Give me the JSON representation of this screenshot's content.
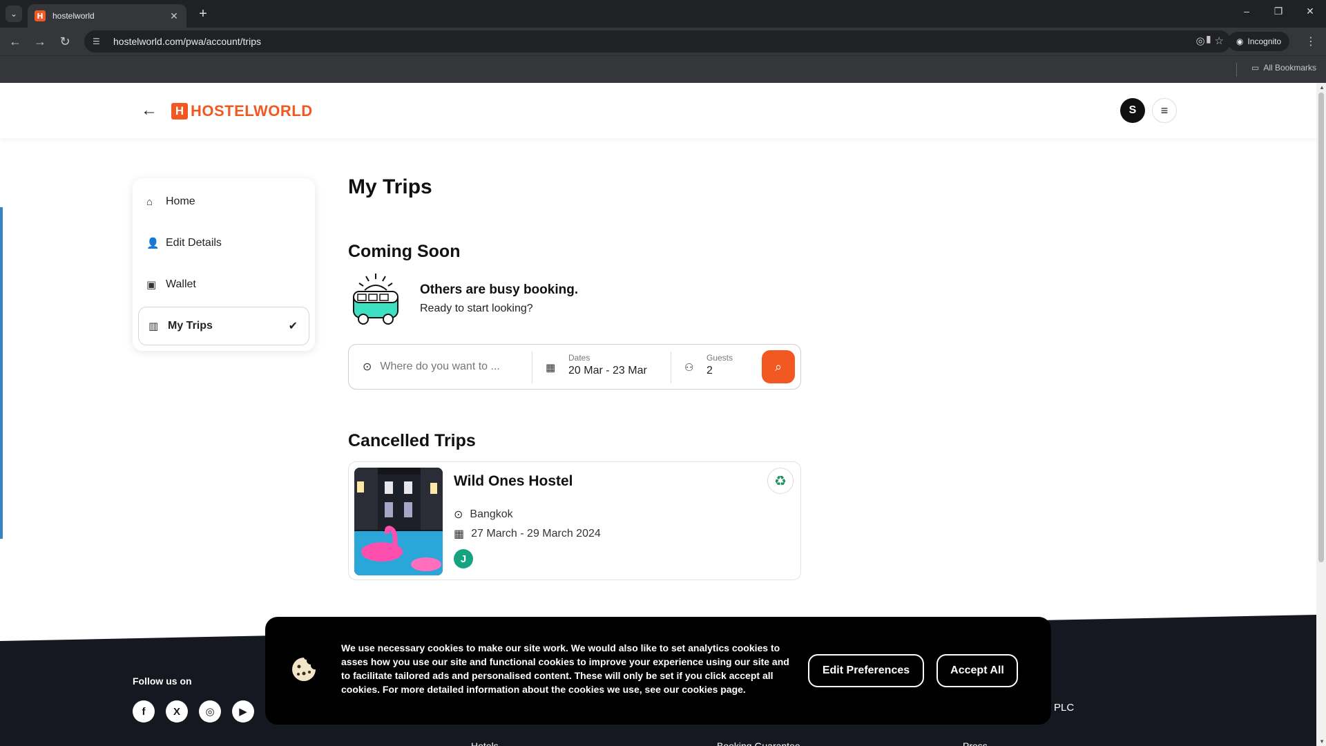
{
  "browser": {
    "tab_title": "hostelworld",
    "favicon_letter": "H",
    "url": "hostelworld.com/pwa/account/trips",
    "incognito_label": "Incognito",
    "bookmarks_label": "All Bookmarks"
  },
  "header": {
    "logo_letter": "H",
    "logo_text": "HOSTELWORLD",
    "avatar_initial": "S"
  },
  "sidebar": {
    "items": [
      {
        "label": "Home",
        "icon": "home-icon"
      },
      {
        "label": "Edit Details",
        "icon": "user-icon"
      },
      {
        "label": "Wallet",
        "icon": "wallet-icon"
      },
      {
        "label": "My Trips",
        "icon": "map-icon",
        "active": true
      }
    ]
  },
  "main": {
    "page_title": "My Trips",
    "coming_soon_title": "Coming Soon",
    "promo_headline": "Others are busy booking.",
    "promo_subtext": "Ready to start looking?",
    "search": {
      "where_placeholder": "Where do you want to ...",
      "dates_label": "Dates",
      "dates_value": "20 Mar - 23 Mar",
      "guests_label": "Guests",
      "guests_value": "2"
    },
    "cancelled_title": "Cancelled Trips",
    "trip": {
      "name": "Wild Ones Hostel",
      "location": "Bangkok",
      "dates": "27 March - 29 March 2024",
      "badge_letter": "J"
    }
  },
  "footer": {
    "follow_label": "Follow us on",
    "links": [
      "Hotels",
      "Booking Guarantee",
      "Press"
    ],
    "plc_text": "PLC"
  },
  "cookie": {
    "text": "We use necessary cookies to make our site work. We would also like to set analytics cookies to asses how you use our site and functional cookies to improve your experience using our site and to facilitate tailored ads and personalised content. These will only be set if you click accept all cookies. For more detailed information about the cookies we use, see our cookies page.",
    "edit_label": "Edit Preferences",
    "accept_label": "Accept All"
  },
  "colors": {
    "brand": "#f25822",
    "eco_green": "#1e8f5e",
    "badge_green": "#16a37f",
    "footer_bg": "#161821"
  }
}
